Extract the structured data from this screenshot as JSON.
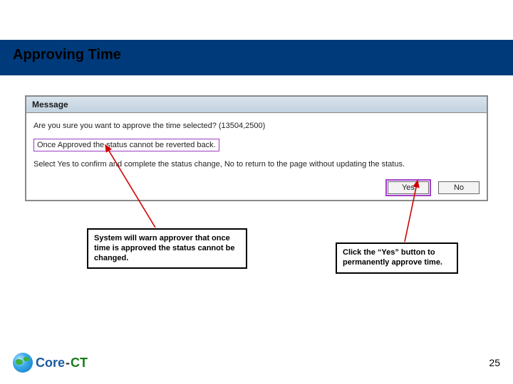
{
  "slide": {
    "title": "Approving Time"
  },
  "dialog": {
    "titlebar": "Message",
    "confirm_text": "Are you sure you want to approve the time selected? (13504,2500)",
    "warning_text": "Once Approved the status cannot be reverted back.",
    "instruction_text": "Select Yes to confirm and complete the status change, No to return to the page without updating the status.",
    "yes_label": "Yes",
    "no_label": "No"
  },
  "callouts": {
    "left": "System will warn approver that once time is approved the status cannot be changed.",
    "right": "Click the “Yes” button to permanently approve time."
  },
  "footer": {
    "logo_core": "Core",
    "logo_dash": "-",
    "logo_ct": "CT",
    "page_number": "25"
  }
}
